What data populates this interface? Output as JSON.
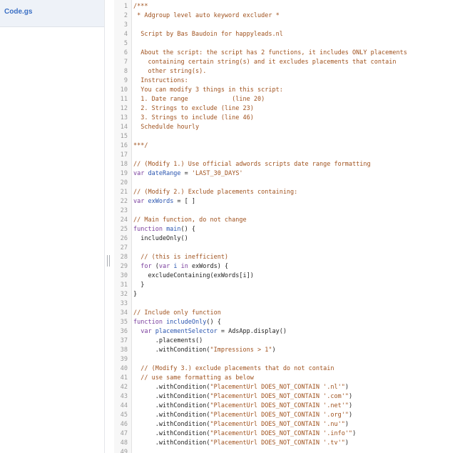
{
  "sidebar": {
    "files": [
      {
        "name": "Code.gs",
        "active": true
      }
    ]
  },
  "editor": {
    "lines": [
      {
        "n": "1",
        "segs": [
          {
            "t": "/***",
            "c": "comment"
          }
        ]
      },
      {
        "n": "2",
        "segs": [
          {
            "t": " * Adgroup level auto keyword excluder *",
            "c": "comment"
          }
        ]
      },
      {
        "n": "3",
        "segs": [
          {
            "t": "",
            "c": "comment"
          }
        ]
      },
      {
        "n": "4",
        "segs": [
          {
            "t": "  Script by Bas Baudoin for happyleads.nl",
            "c": "comment"
          }
        ]
      },
      {
        "n": "5",
        "segs": [
          {
            "t": "",
            "c": "comment"
          }
        ]
      },
      {
        "n": "6",
        "segs": [
          {
            "t": "  About the script: the script has 2 functions, it includes ONLY placements",
            "c": "comment"
          }
        ]
      },
      {
        "n": "7",
        "segs": [
          {
            "t": "    containing certain string(s) and it excludes placements that contain",
            "c": "comment"
          }
        ]
      },
      {
        "n": "8",
        "segs": [
          {
            "t": "    other string(s).",
            "c": "comment"
          }
        ]
      },
      {
        "n": "9",
        "segs": [
          {
            "t": "  Instructions:",
            "c": "comment"
          }
        ]
      },
      {
        "n": "10",
        "segs": [
          {
            "t": "  You can modify 3 things in this script:",
            "c": "comment"
          }
        ]
      },
      {
        "n": "11",
        "segs": [
          {
            "t": "  1. Date range            (line 20)",
            "c": "comment"
          }
        ]
      },
      {
        "n": "12",
        "segs": [
          {
            "t": "  2. Strings to exclude (line 23)",
            "c": "comment"
          }
        ]
      },
      {
        "n": "13",
        "segs": [
          {
            "t": "  3. Strings to include (line 46)",
            "c": "comment"
          }
        ]
      },
      {
        "n": "14",
        "segs": [
          {
            "t": "  Schedulde hourly",
            "c": "comment"
          }
        ]
      },
      {
        "n": "15",
        "segs": [
          {
            "t": "",
            "c": "comment"
          }
        ]
      },
      {
        "n": "16",
        "segs": [
          {
            "t": "***/",
            "c": "comment"
          }
        ]
      },
      {
        "n": "17",
        "segs": [
          {
            "t": "",
            "c": "plain"
          }
        ]
      },
      {
        "n": "18",
        "segs": [
          {
            "t": "// (Modify 1.) Use official adwords scripts date range formatting",
            "c": "comment"
          }
        ]
      },
      {
        "n": "19",
        "segs": [
          {
            "t": "var ",
            "c": "kw"
          },
          {
            "t": "dateRange",
            "c": "def"
          },
          {
            "t": " = ",
            "c": "plain"
          },
          {
            "t": "'LAST_30_DAYS'",
            "c": "str"
          }
        ]
      },
      {
        "n": "20",
        "segs": [
          {
            "t": "",
            "c": "plain"
          }
        ]
      },
      {
        "n": "21",
        "segs": [
          {
            "t": "// (Modify 2.) Exclude placements containing:",
            "c": "comment"
          }
        ]
      },
      {
        "n": "22",
        "segs": [
          {
            "t": "var ",
            "c": "kw"
          },
          {
            "t": "exWords",
            "c": "def"
          },
          {
            "t": " = [ ]",
            "c": "plain"
          }
        ]
      },
      {
        "n": "23",
        "segs": [
          {
            "t": "",
            "c": "plain"
          }
        ]
      },
      {
        "n": "24",
        "segs": [
          {
            "t": "// Main function, do not change",
            "c": "comment"
          }
        ]
      },
      {
        "n": "25",
        "segs": [
          {
            "t": "function ",
            "c": "kw"
          },
          {
            "t": "main",
            "c": "def"
          },
          {
            "t": "() {",
            "c": "plain"
          }
        ]
      },
      {
        "n": "26",
        "segs": [
          {
            "t": "  includeOnly()",
            "c": "plain"
          }
        ]
      },
      {
        "n": "27",
        "segs": [
          {
            "t": "",
            "c": "plain"
          }
        ]
      },
      {
        "n": "28",
        "segs": [
          {
            "t": "  // (this is inefficient)",
            "c": "comment"
          }
        ]
      },
      {
        "n": "29",
        "segs": [
          {
            "t": "  for ",
            "c": "kw"
          },
          {
            "t": "(",
            "c": "plain"
          },
          {
            "t": "var ",
            "c": "kw"
          },
          {
            "t": "i",
            "c": "def"
          },
          {
            "t": " ",
            "c": "plain"
          },
          {
            "t": "in",
            "c": "kw"
          },
          {
            "t": " exWords) {",
            "c": "plain"
          }
        ]
      },
      {
        "n": "30",
        "segs": [
          {
            "t": "    excludeContaining(exWords[i])",
            "c": "plain"
          }
        ]
      },
      {
        "n": "31",
        "segs": [
          {
            "t": "  }",
            "c": "plain"
          }
        ]
      },
      {
        "n": "32",
        "segs": [
          {
            "t": "}",
            "c": "plain"
          }
        ]
      },
      {
        "n": "33",
        "segs": [
          {
            "t": "",
            "c": "plain"
          }
        ]
      },
      {
        "n": "34",
        "segs": [
          {
            "t": "// Include only function",
            "c": "comment"
          }
        ]
      },
      {
        "n": "35",
        "segs": [
          {
            "t": "function ",
            "c": "kw"
          },
          {
            "t": "includeOnly",
            "c": "def"
          },
          {
            "t": "() {",
            "c": "plain"
          }
        ]
      },
      {
        "n": "36",
        "segs": [
          {
            "t": "  var ",
            "c": "kw"
          },
          {
            "t": "placementSelector",
            "c": "def"
          },
          {
            "t": " = AdsApp.display()",
            "c": "plain"
          }
        ]
      },
      {
        "n": "37",
        "segs": [
          {
            "t": "      .placements()",
            "c": "plain"
          }
        ]
      },
      {
        "n": "38",
        "segs": [
          {
            "t": "      .withCondition(",
            "c": "plain"
          },
          {
            "t": "\"Impressions > 1\"",
            "c": "str"
          },
          {
            "t": ")",
            "c": "plain"
          }
        ]
      },
      {
        "n": "39",
        "segs": [
          {
            "t": "",
            "c": "plain"
          }
        ]
      },
      {
        "n": "40",
        "segs": [
          {
            "t": "  // (Modify 3.) exclude placements that do not contain",
            "c": "comment"
          }
        ]
      },
      {
        "n": "41",
        "segs": [
          {
            "t": "  // use same formatting as below",
            "c": "comment"
          }
        ]
      },
      {
        "n": "42",
        "segs": [
          {
            "t": "      .withCondition(",
            "c": "plain"
          },
          {
            "t": "\"PlacementUrl DOES_NOT_CONTAIN '.nl'\"",
            "c": "str"
          },
          {
            "t": ")",
            "c": "plain"
          }
        ]
      },
      {
        "n": "43",
        "segs": [
          {
            "t": "      .withCondition(",
            "c": "plain"
          },
          {
            "t": "\"PlacementUrl DOES_NOT_CONTAIN '.com'\"",
            "c": "str"
          },
          {
            "t": ")",
            "c": "plain"
          }
        ]
      },
      {
        "n": "44",
        "segs": [
          {
            "t": "      .withCondition(",
            "c": "plain"
          },
          {
            "t": "\"PlacementUrl DOES_NOT_CONTAIN '.net'\"",
            "c": "str"
          },
          {
            "t": ")",
            "c": "plain"
          }
        ]
      },
      {
        "n": "45",
        "segs": [
          {
            "t": "      .withCondition(",
            "c": "plain"
          },
          {
            "t": "\"PlacementUrl DOES_NOT_CONTAIN '.org'\"",
            "c": "str"
          },
          {
            "t": ")",
            "c": "plain"
          }
        ]
      },
      {
        "n": "46",
        "segs": [
          {
            "t": "      .withCondition(",
            "c": "plain"
          },
          {
            "t": "\"PlacementUrl DOES_NOT_CONTAIN '.nu'\"",
            "c": "str"
          },
          {
            "t": ")",
            "c": "plain"
          }
        ]
      },
      {
        "n": "47",
        "segs": [
          {
            "t": "      .withCondition(",
            "c": "plain"
          },
          {
            "t": "\"PlacementUrl DOES_NOT_CONTAIN '.info'\"",
            "c": "str"
          },
          {
            "t": ")",
            "c": "plain"
          }
        ]
      },
      {
        "n": "48",
        "segs": [
          {
            "t": "      .withCondition(",
            "c": "plain"
          },
          {
            "t": "\"PlacementUrl DOES_NOT_CONTAIN '.tv'\"",
            "c": "str"
          },
          {
            "t": ")",
            "c": "plain"
          }
        ]
      },
      {
        "n": "49",
        "segs": [
          {
            "t": "",
            "c": "plain"
          }
        ]
      }
    ]
  },
  "colors": {
    "comment": "#a0521e",
    "keyword": "#7a3e9d",
    "definition": "#2a55b0",
    "string": "#a0521e",
    "file_name": "#3a6fc4"
  }
}
